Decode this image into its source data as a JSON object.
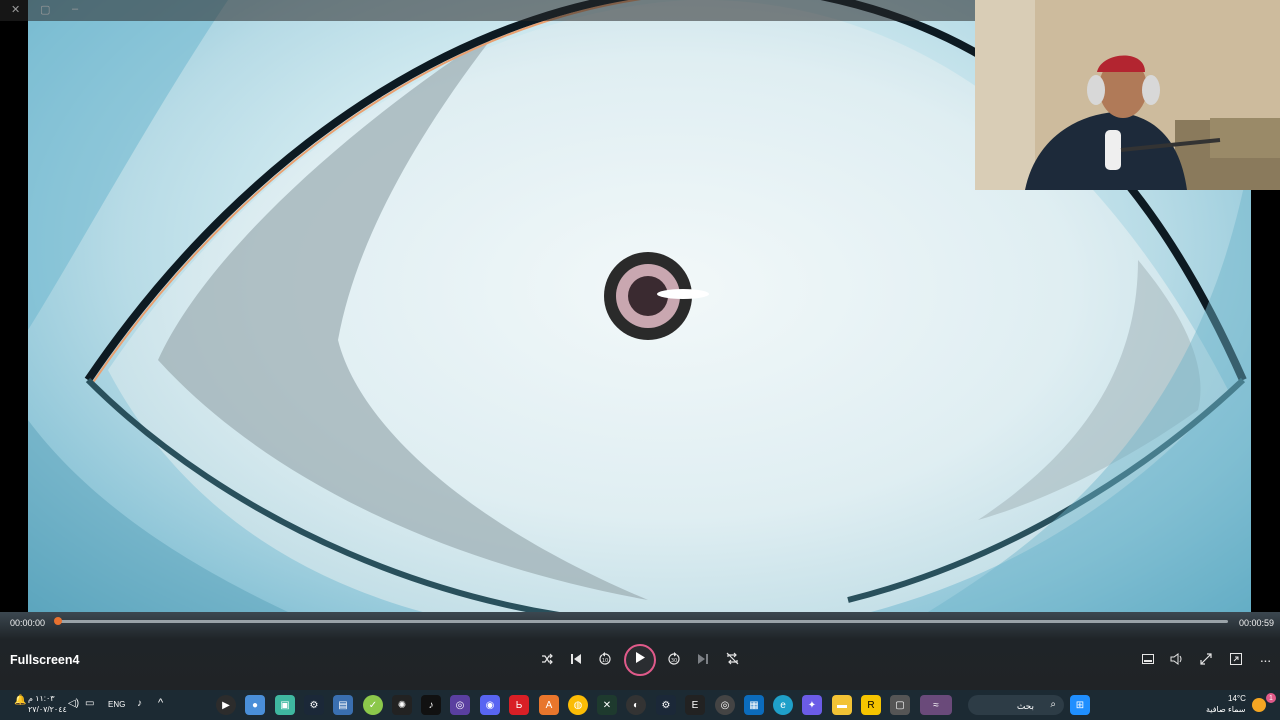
{
  "player": {
    "title": "Fullscreen4",
    "current_time": "00:00:00",
    "total_time": "00:00:59",
    "progress": 0.0,
    "accent_color": "#e8712f"
  },
  "taskbar": {
    "search_placeholder": "بحث",
    "weather_temp": "14°C",
    "weather_desc": "سماء صافية",
    "language": "ENG",
    "clock_time": "١١:٠٣ م",
    "clock_date": "٢٧/٠٧/٢٠٤٤",
    "notification_count": "1"
  },
  "icons": {
    "shuffle": "shuffle-icon",
    "previous": "skip-previous-icon",
    "rewind": "rewind-10-icon",
    "play": "play-icon",
    "forward": "forward-30-icon",
    "next": "skip-next-icon",
    "repeat": "repeat-off-icon"
  }
}
